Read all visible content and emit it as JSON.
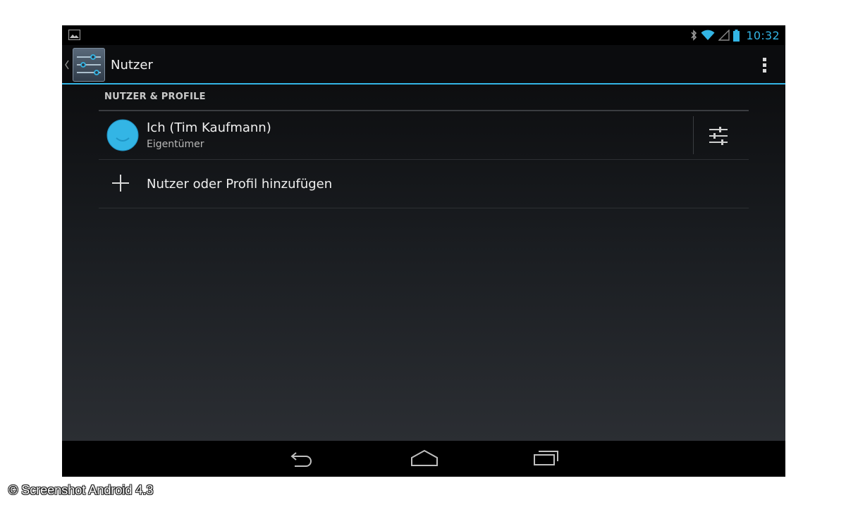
{
  "status_bar": {
    "time": "10:32",
    "icons": [
      "image-notification-icon",
      "bluetooth-icon",
      "wifi-icon",
      "cell-signal-icon",
      "battery-icon"
    ],
    "accent_color": "#33b5e5"
  },
  "action_bar": {
    "title": "Nutzer",
    "app_icon": "settings-sliders-icon",
    "overflow_icon": "overflow-menu-icon",
    "divider_color": "#33b5e5"
  },
  "section": {
    "header": "NUTZER & PROFILE"
  },
  "users": [
    {
      "name": "Ich (Tim Kaufmann)",
      "role": "Eigentümer",
      "avatar_color": "#33b5e5",
      "settings_icon": "sliders-icon"
    }
  ],
  "add_user": {
    "label": "Nutzer oder Profil hinzufügen",
    "icon": "plus-icon"
  },
  "nav_bar": {
    "buttons": [
      "back-icon",
      "home-icon",
      "recent-apps-icon"
    ]
  },
  "caption": "© Screenshot Android 4.3"
}
